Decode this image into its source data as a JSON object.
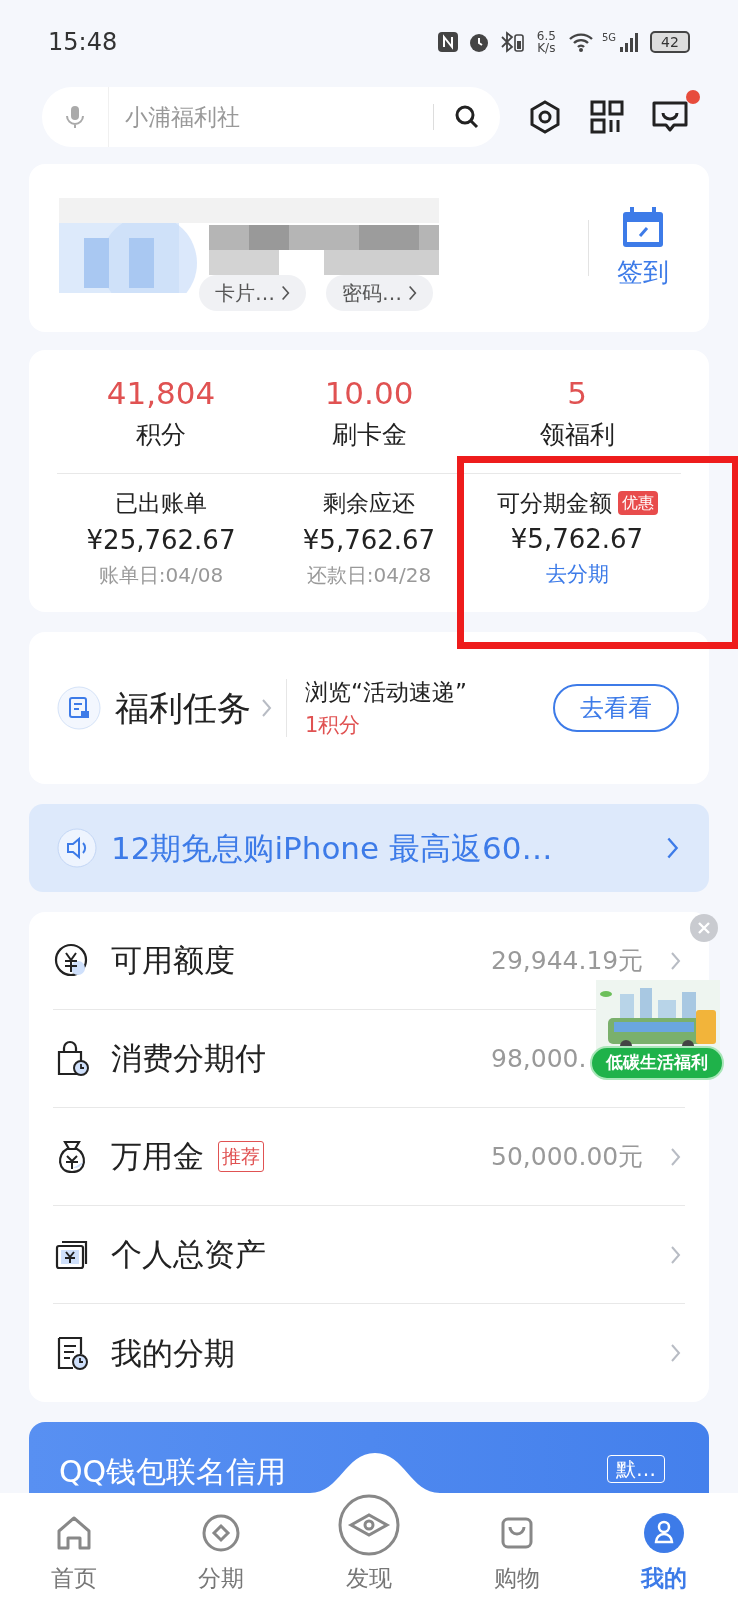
{
  "status_bar": {
    "time": "15:48",
    "speed": "6.5",
    "speed_unit": "K/s",
    "network": "5G",
    "battery": "42"
  },
  "search": {
    "placeholder": "小浦福利社"
  },
  "message_unread": true,
  "profile": {
    "chips": [
      "卡片…",
      "密码…"
    ],
    "checkin": "签到"
  },
  "stats": [
    {
      "value": "41,804",
      "label": "积分"
    },
    {
      "value": "10.00",
      "label": "刷卡金"
    },
    {
      "value": "5",
      "label": "领福利"
    }
  ],
  "bills": [
    {
      "title": "已出账单",
      "amount": "¥25,762.67",
      "note": "账单日:04/08",
      "kind": "date",
      "highlighted": false
    },
    {
      "title": "剩余应还",
      "amount": "¥5,762.67",
      "note": "还款日:04/28",
      "kind": "date",
      "highlighted": false
    },
    {
      "title": "可分期金额",
      "tag": "优惠",
      "amount": "¥5,762.67",
      "note": "去分期",
      "kind": "link",
      "highlighted": true
    }
  ],
  "task": {
    "title": "福利任务",
    "desc": "浏览“活动速递”",
    "reward": "1积分",
    "button": "去看看"
  },
  "notice": "12期免息购iPhone 最高返60…",
  "menu": [
    {
      "label": "可用额度",
      "value": "29,944.19元",
      "chevron": true
    },
    {
      "label": "消费分期付",
      "value": "98,000.",
      "chevron": false
    },
    {
      "label": "万用金",
      "tag": "推荐",
      "value": "50,000.00元",
      "chevron": true
    },
    {
      "label": "个人总资产",
      "chevron": true
    },
    {
      "label": "我的分期",
      "chevron": true
    }
  ],
  "float_ad": {
    "label": "低碳生活福利"
  },
  "card": {
    "title": "QQ钱包联名信用",
    "badge": "默…"
  },
  "tabs": [
    {
      "label": "首页",
      "selected": false
    },
    {
      "label": "分期",
      "selected": false
    },
    {
      "label": "发现",
      "selected": false
    },
    {
      "label": "购物",
      "selected": false
    },
    {
      "label": "我的",
      "selected": true
    }
  ]
}
